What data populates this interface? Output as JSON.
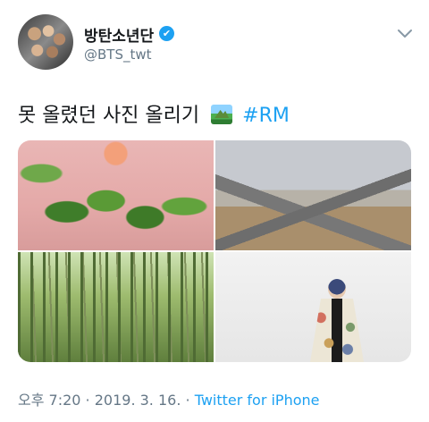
{
  "author": {
    "display_name": "방탄소년단",
    "handle": "@BTS_twt",
    "verified_mark": "✔"
  },
  "tweet": {
    "text": "못 올렸던 사진 올리기",
    "emoji_icon": "national-park-emoji-icon",
    "hashtag": "#RM"
  },
  "media": [
    {
      "name": "photo-flowers"
    },
    {
      "name": "photo-road"
    },
    {
      "name": "photo-bamboo"
    },
    {
      "name": "photo-person"
    }
  ],
  "meta": {
    "time": "오후 7:20",
    "sep1": " · ",
    "date": "2019. 3. 16.",
    "sep2": " · ",
    "source": "Twitter for iPhone"
  },
  "colors": {
    "accent": "#1da1f2",
    "muted": "#657786",
    "text": "#14171a"
  }
}
